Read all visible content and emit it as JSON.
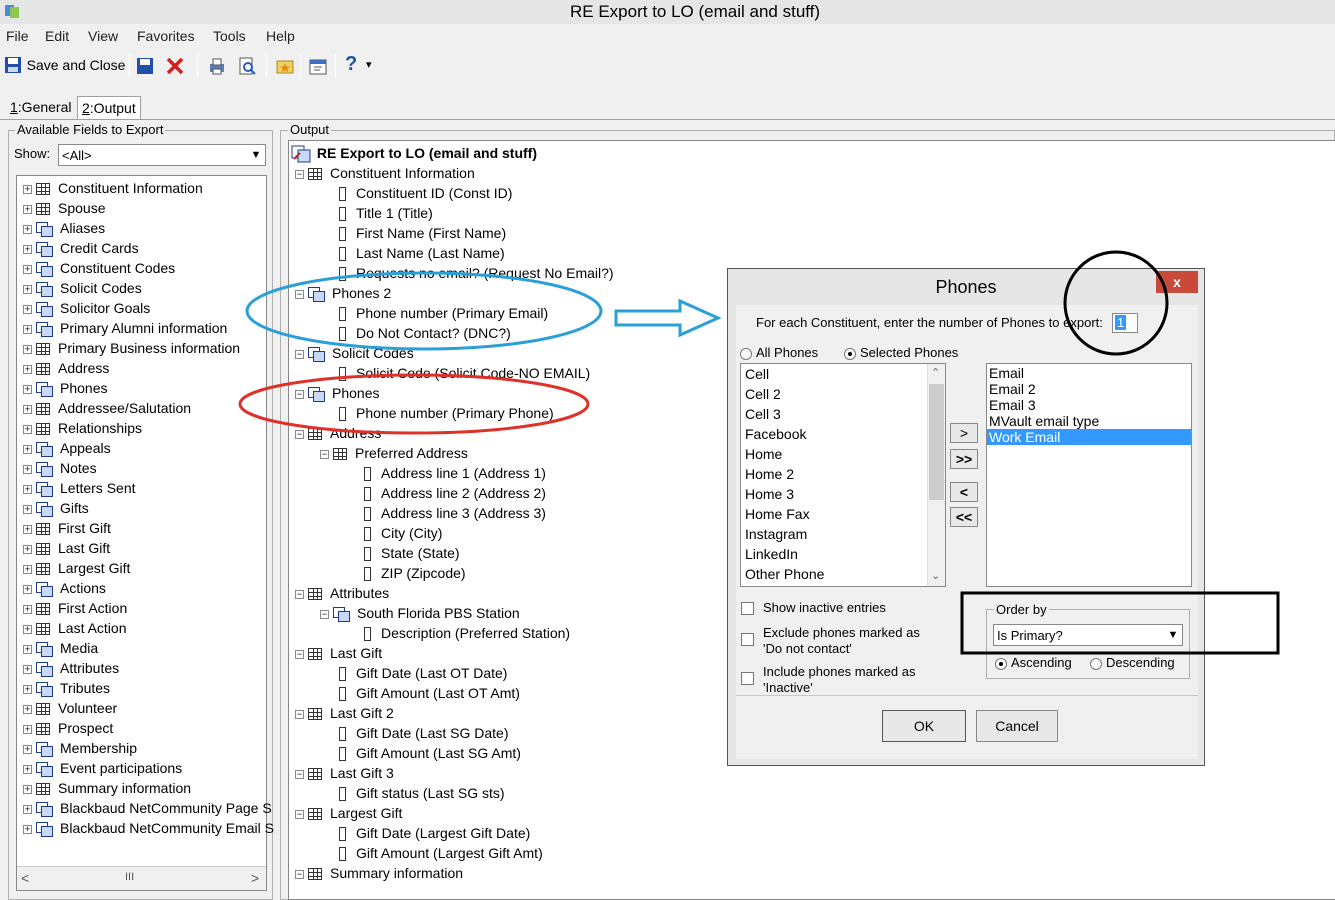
{
  "window": {
    "title": "RE Export to LO (email and stuff)"
  },
  "menu": [
    "File",
    "Edit",
    "View",
    "Favorites",
    "Tools",
    "Help"
  ],
  "toolbar": {
    "save_close": "Save and Close",
    "help": "?",
    "help_arrow": "▾"
  },
  "tabs": [
    {
      "prefix": "1",
      "label": ":General"
    },
    {
      "prefix": "2",
      "label": ":Output"
    }
  ],
  "available": {
    "group_title": "Available Fields to Export",
    "show_label": "Show:",
    "show_value": "<All>",
    "items": [
      {
        "label": "Constituent Information",
        "icon": "grid"
      },
      {
        "label": "Spouse",
        "icon": "grid"
      },
      {
        "label": "Aliases",
        "icon": "multi"
      },
      {
        "label": "Credit Cards",
        "icon": "multi"
      },
      {
        "label": "Constituent Codes",
        "icon": "multi"
      },
      {
        "label": "Solicit Codes",
        "icon": "multi"
      },
      {
        "label": "Solicitor Goals",
        "icon": "multi"
      },
      {
        "label": "Primary Alumni information",
        "icon": "multi"
      },
      {
        "label": "Primary Business information",
        "icon": "grid"
      },
      {
        "label": "Address",
        "icon": "grid"
      },
      {
        "label": "Phones",
        "icon": "multi"
      },
      {
        "label": "Addressee/Salutation",
        "icon": "grid"
      },
      {
        "label": "Relationships",
        "icon": "grid"
      },
      {
        "label": "Appeals",
        "icon": "multi"
      },
      {
        "label": "Notes",
        "icon": "multi"
      },
      {
        "label": "Letters Sent",
        "icon": "multi"
      },
      {
        "label": "Gifts",
        "icon": "multi"
      },
      {
        "label": "First Gift",
        "icon": "grid"
      },
      {
        "label": "Last Gift",
        "icon": "grid"
      },
      {
        "label": "Largest Gift",
        "icon": "grid"
      },
      {
        "label": "Actions",
        "icon": "multi"
      },
      {
        "label": "First Action",
        "icon": "grid"
      },
      {
        "label": "Last Action",
        "icon": "grid"
      },
      {
        "label": "Media",
        "icon": "multi"
      },
      {
        "label": "Attributes",
        "icon": "multi"
      },
      {
        "label": "Tributes",
        "icon": "multi"
      },
      {
        "label": "Volunteer",
        "icon": "grid"
      },
      {
        "label": "Prospect",
        "icon": "grid"
      },
      {
        "label": "Membership",
        "icon": "multi"
      },
      {
        "label": "Event participations",
        "icon": "multi"
      },
      {
        "label": "Summary information",
        "icon": "grid"
      },
      {
        "label": "Blackbaud NetCommunity Page S",
        "icon": "multi"
      },
      {
        "label": "Blackbaud NetCommunity Email S",
        "icon": "multi"
      }
    ],
    "hscroll_thumb": "III"
  },
  "output": {
    "group_title": "Output",
    "root": "RE Export to LO (email and stuff)",
    "rows": [
      {
        "label": "Constituent Information",
        "level": 1,
        "icon": "grid",
        "pm": "-"
      },
      {
        "label": "Constituent ID (Const ID)",
        "level": 2,
        "icon": "field"
      },
      {
        "label": "Title 1 (Title)",
        "level": 2,
        "icon": "field"
      },
      {
        "label": "First Name (First Name)",
        "level": 2,
        "icon": "field"
      },
      {
        "label": "Last Name (Last Name)",
        "level": 2,
        "icon": "field"
      },
      {
        "label": "Requests no email? (Request No Email?)",
        "level": 2,
        "icon": "field"
      },
      {
        "label": "Phones 2",
        "level": 1,
        "icon": "multi",
        "pm": "-"
      },
      {
        "label": "Phone number (Primary Email)",
        "level": 2,
        "icon": "field"
      },
      {
        "label": "Do Not Contact? (DNC?)",
        "level": 2,
        "icon": "field"
      },
      {
        "label": "Solicit Codes",
        "level": 1,
        "icon": "multi",
        "pm": "-"
      },
      {
        "label": "Solicit Code (Solicit Code-NO EMAIL)",
        "level": 2,
        "icon": "field"
      },
      {
        "label": "Phones",
        "level": 1,
        "icon": "multi",
        "pm": "-"
      },
      {
        "label": "Phone number (Primary Phone)",
        "level": 2,
        "icon": "field"
      },
      {
        "label": "Address",
        "level": 1,
        "icon": "grid",
        "pm": "-"
      },
      {
        "label": "Preferred Address",
        "level": 2,
        "icon": "grid",
        "pm": "-"
      },
      {
        "label": "Address line 1 (Address 1)",
        "level": 3,
        "icon": "field"
      },
      {
        "label": "Address line 2 (Address 2)",
        "level": 3,
        "icon": "field"
      },
      {
        "label": "Address line 3 (Address 3)",
        "level": 3,
        "icon": "field"
      },
      {
        "label": "City (City)",
        "level": 3,
        "icon": "field"
      },
      {
        "label": "State (State)",
        "level": 3,
        "icon": "field"
      },
      {
        "label": "ZIP (Zipcode)",
        "level": 3,
        "icon": "field"
      },
      {
        "label": "Attributes",
        "level": 1,
        "icon": "grid",
        "pm": "-"
      },
      {
        "label": "South Florida PBS Station",
        "level": 2,
        "icon": "multi",
        "pm": "-"
      },
      {
        "label": "Description (Preferred Station)",
        "level": 3,
        "icon": "field"
      },
      {
        "label": "Last Gift",
        "level": 1,
        "icon": "grid",
        "pm": "-"
      },
      {
        "label": "Gift Date (Last OT Date)",
        "level": 2,
        "icon": "field"
      },
      {
        "label": "Gift Amount (Last OT Amt)",
        "level": 2,
        "icon": "field"
      },
      {
        "label": "Last Gift 2",
        "level": 1,
        "icon": "grid",
        "pm": "-"
      },
      {
        "label": "Gift Date (Last SG Date)",
        "level": 2,
        "icon": "field"
      },
      {
        "label": "Gift Amount (Last SG Amt)",
        "level": 2,
        "icon": "field"
      },
      {
        "label": "Last Gift 3",
        "level": 1,
        "icon": "grid",
        "pm": "-"
      },
      {
        "label": "Gift status (Last SG sts)",
        "level": 2,
        "icon": "field"
      },
      {
        "label": "Largest Gift",
        "level": 1,
        "icon": "grid",
        "pm": "-"
      },
      {
        "label": "Gift Date (Largest Gift Date)",
        "level": 2,
        "icon": "field"
      },
      {
        "label": "Gift Amount (Largest Gift Amt)",
        "level": 2,
        "icon": "field"
      },
      {
        "label": "Summary information",
        "level": 1,
        "icon": "grid",
        "pm": "-"
      }
    ]
  },
  "annotations": {
    "blue": "#2a9fd8",
    "red": "#e0302a",
    "black": "#000000"
  },
  "dialog": {
    "title": "Phones",
    "close": "x",
    "prompt": "For each Constituent, enter the number of Phones to export:",
    "count_value": "1",
    "radio_all": "All Phones",
    "radio_selected": "Selected Phones",
    "left_list": [
      "Cell",
      "Cell 2",
      "Cell 3",
      "Facebook",
      "Home",
      "Home 2",
      "Home 3",
      "Home Fax",
      "Instagram",
      "LinkedIn",
      "Other Phone"
    ],
    "right_list": [
      "Email",
      "Email 2",
      "Email 3",
      "MVault email type",
      "Work Email"
    ],
    "right_selected_index": 4,
    "move_buttons": [
      ">",
      ">>",
      "<",
      "<<"
    ],
    "show_inactive": "Show inactive entries",
    "exclude_dnc": "Exclude phones marked as 'Do not contact'",
    "include_inactive": "Include phones marked as 'Inactive'",
    "order_by_label": "Order by",
    "order_by_value": "Is Primary?",
    "ascending": "Ascending",
    "descending": "Descending",
    "ok": "OK",
    "cancel": "Cancel"
  }
}
